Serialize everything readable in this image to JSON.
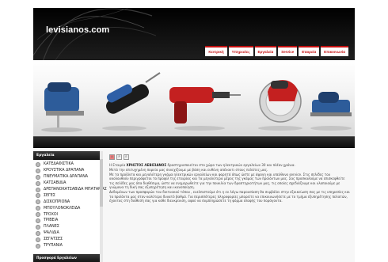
{
  "header": {
    "logo": "levisianos.com",
    "nav": [
      {
        "label": "Κεντρική"
      },
      {
        "label": "Υπηρεσίες"
      },
      {
        "label": "Εργαλεία"
      },
      {
        "label": "Service"
      },
      {
        "label": "Εταιρεία"
      },
      {
        "label": "Επικοινωνία"
      }
    ]
  },
  "sidebar": {
    "title": "Εργαλεία",
    "items": [
      "ΚΑΤΕΔΑΦΙΣΤΙΚΑ",
      "ΚΡΟΥΣΤΙΚΑ ΔΡΑΠΑΝΑ",
      "ΠΝΕΥΜΑΤΙΚΑ ΔΡΑΠΑΝΑ",
      "ΚΑΤΣΑΒΙΔΙΑ",
      "ΔΡΕΠΑΝΟΚΑΤΣΑΒΙΔΑ ΜΠΑΤΑΡΙΑΣ",
      "ΣΕΓΕΣ",
      "ΔΙΣΚΟΠΡΙΟΝΑ",
      "ΜΠΟΥΛΟΝΟΚΛΕΙΔΑ",
      "ΤΡΟΧΟΙ",
      "ΤΡΙΒΕΙΑ",
      "ΠΛΑΝΕΣ",
      "ΨΑΛΙΔΙΑ",
      "ΣΕΓΑΤΣΕΣ",
      "ΤΡΥΠΑΝΙΑ"
    ],
    "footer": "Προσφορά Εργαλείων"
  },
  "toolbar": {
    "pdf": "A",
    "print": "P",
    "email": "E"
  },
  "main": {
    "intro_prefix": "Η Εταιρία",
    "intro_company": "ΧΡΗΣΤΟΣ ΛΕΒΙΣΙΑΝΟΣ",
    "intro_suffix": "δραστηριοποιείται στο χώρο των ηλεκτρικών εργαλείων 30 και πλέον χρόνια.",
    "p2": "Μετά την επιτυχημένη πορεία μας συνεχίζουμε με βάση και ευθύνη απέναντι στους πελάτες μας.",
    "p3": "Με τα προϊόντα και μεγαλύτερη γκάμα ηλεκτρικών εργαλείων και φορητά όπως ώστε με άψογη και υπεύθυνο service. Στις σελίδες του ακολουθούν περιγράφεται το προφίλ της εταιρίας και τα μεγαλύτερα μέρος της γκάμας των προϊόντων μας. Σας προσκαλούμε να επισκεφθείτε τις σελίδες μας όπα διαθέσιμα, ώστε να ενημερωθείτε για την ποικιλία των δραστηριοτήτων μας, τις οποίες σχεδιάζουμε και υλοποιούμε με γνώμονα τη δική σας εξυπηρέτηση και ικανοποίηση.",
    "p4": "Δεδομένων των προσφορών του δικτυακού τόπου , ευελπιστούμε ότι η εν λόγω παρουσίαση θα συμβάλει στην εξοικείωση σας με τις υπηρεσίες και τα προϊόντα μας στον καλύτερο δυνατό βαθμό. Για περισσότερες πληροφορίες μπορείτε να επικοινωνήσετε με το τμήμα εξυπηρέτησης πελατών, έχοντας στη διάθεσή σας για κάθε διευκρίνιση, αφού να συμπληρώσετε τη φόρμα επαφής του ποράγοντα."
  }
}
